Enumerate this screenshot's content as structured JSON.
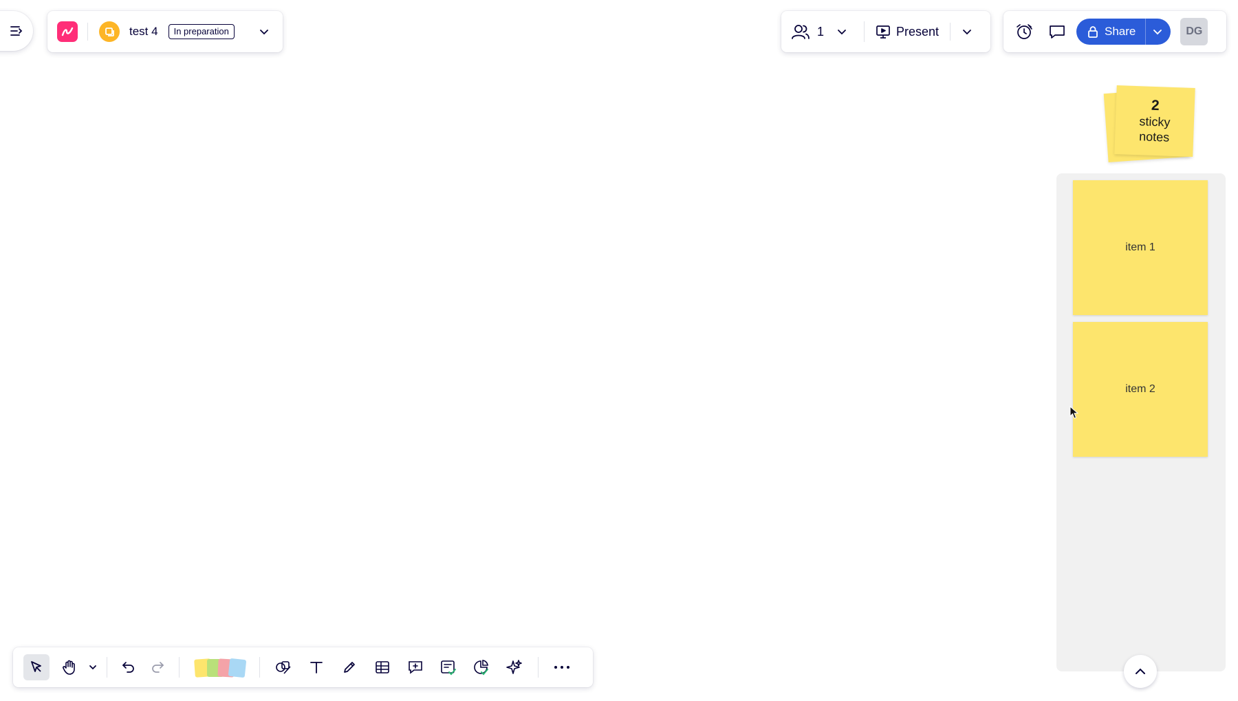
{
  "board": {
    "title": "test 4",
    "status": "In preparation"
  },
  "collaboration": {
    "users_count": "1",
    "present_label": "Present"
  },
  "actions": {
    "share_label": "Share",
    "avatar_initials": "DG"
  },
  "sticky_stack": {
    "count": "2",
    "label": "sticky notes"
  },
  "stickies": [
    {
      "text": "item 1",
      "color": "#fde56d"
    },
    {
      "text": "item 2",
      "color": "#fde56d"
    }
  ],
  "colors": {
    "brand": "#ff2e78",
    "board_icon": "#fdb526",
    "share_button": "#2b5cd9",
    "sticky_yellow": "#fde56d",
    "frame_background": "#f1f1f1"
  },
  "icons": {
    "menu": "menu-collapse-icon",
    "logo": "app-logo-icon",
    "board": "board-icon",
    "users": "users-icon",
    "present": "present-icon",
    "timer": "timer-icon",
    "comments": "comment-icon",
    "lock": "lock-icon"
  }
}
